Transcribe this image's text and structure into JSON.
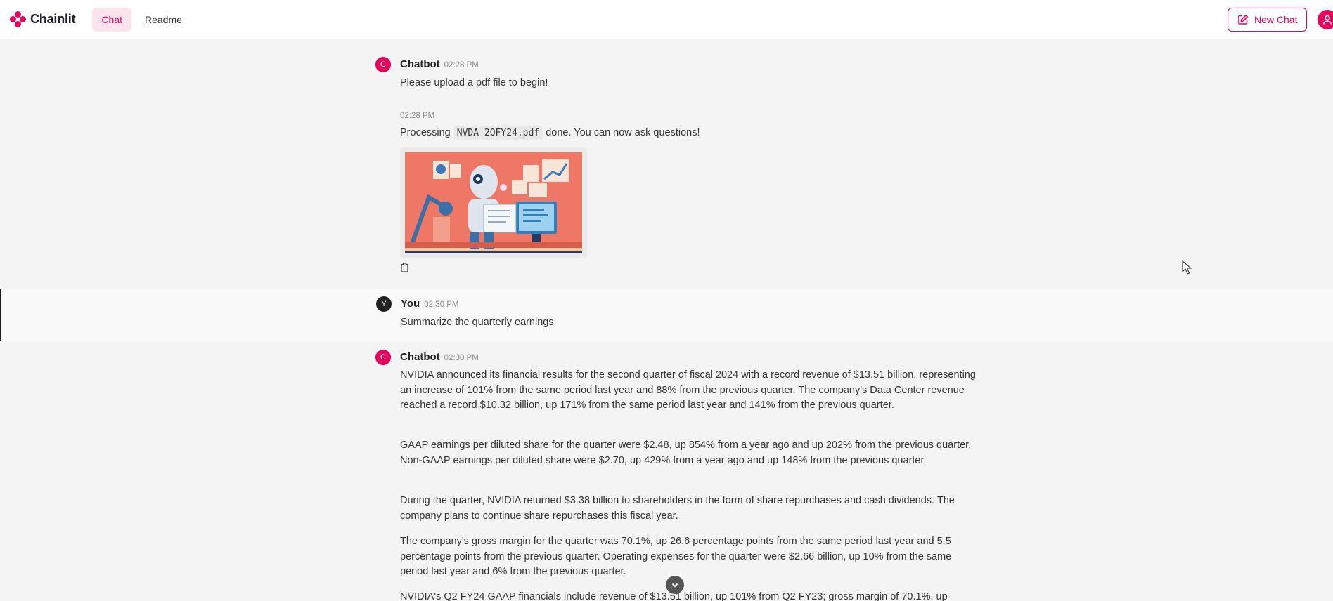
{
  "header": {
    "logo_text": "Chainlit",
    "tabs": [
      {
        "label": "Chat",
        "active": true
      },
      {
        "label": "Readme",
        "active": false
      }
    ],
    "new_chat_label": "New Chat"
  },
  "messages": [
    {
      "avatar_letter": "C",
      "author": "Chatbot",
      "time": "02:28 PM",
      "text": "Please upload a pdf file to begin!"
    },
    {
      "time": "02:28 PM",
      "text_prefix": "Processing",
      "file_name": "NVDA 2QFY24.pdf",
      "text_suffix": "done. You can now ask questions!"
    },
    {
      "avatar_letter": "Y",
      "author": "You",
      "time": "02:30 PM",
      "text": "Summarize the quarterly earnings"
    },
    {
      "avatar_letter": "C",
      "author": "Chatbot",
      "time": "02:30 PM",
      "paragraphs": [
        "NVIDIA announced its financial results for the second quarter of fiscal 2024 with a record revenue of $13.51 billion, representing an increase of 101% from the same period last year and 88% from the previous quarter. The company's Data Center revenue reached a record $10.32 billion, up 171% from the same period last year and 141% from the previous quarter.",
        "GAAP earnings per diluted share for the quarter were $2.48, up 854% from a year ago and up 202% from the previous quarter. Non-GAAP earnings per diluted share were $2.70, up 429% from a year ago and up 148% from the previous quarter.",
        "During the quarter, NVIDIA returned $3.38 billion to shareholders in the form of share repurchases and cash dividends. The company plans to continue share repurchases this fiscal year.",
        "The company's gross margin for the quarter was 70.1%, up 26.6 percentage points from the same period last year and 5.5 percentage points from the previous quarter. Operating expenses for the quarter were $2.66 billion, up 10% from the same period last year and 6% from the previous quarter.",
        "NVIDIA's Q2 FY24 GAAP financials include revenue of $13.51 billion, up 101% from Q2 FY23; gross margin of 70.1%, up"
      ]
    }
  ],
  "colors": {
    "brand": "#e6005c",
    "brand_light": "#fce4ec",
    "page_bg": "#f4f4f4",
    "user_bg": "#f9f9f9"
  }
}
